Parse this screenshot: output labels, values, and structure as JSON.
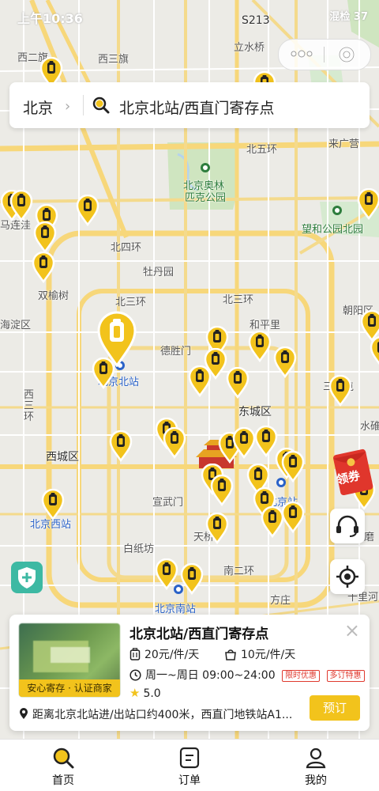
{
  "status_bar": {
    "time": "上午10:36",
    "right": "混检 37"
  },
  "search": {
    "city": "北京",
    "chevron": "›",
    "query": "北京北站/西直门寄存点"
  },
  "map_labels": [
    {
      "text": "S213",
      "cls": "dark"
    },
    {
      "text": "立水桥",
      "cls": ""
    },
    {
      "text": "西二旗",
      "cls": ""
    },
    {
      "text": "西三旗",
      "cls": ""
    },
    {
      "text": "北五环",
      "cls": ""
    },
    {
      "text": "来广营",
      "cls": ""
    },
    {
      "text": "北京奥林",
      "cls": "green"
    },
    {
      "text": "匹克公园",
      "cls": "green"
    },
    {
      "text": "望和公园北园",
      "cls": "green"
    },
    {
      "text": "马连洼",
      "cls": ""
    },
    {
      "text": "北四环",
      "cls": ""
    },
    {
      "text": "牡丹园",
      "cls": ""
    },
    {
      "text": "双榆树",
      "cls": ""
    },
    {
      "text": "北三环",
      "cls": ""
    },
    {
      "text": "北三环",
      "cls": ""
    },
    {
      "text": "朝阳区",
      "cls": ""
    },
    {
      "text": "和平里",
      "cls": ""
    },
    {
      "text": "海淀区",
      "cls": ""
    },
    {
      "text": "德胜门",
      "cls": ""
    },
    {
      "text": "北京北站",
      "cls": "blue"
    },
    {
      "text": "三元屯",
      "cls": ""
    },
    {
      "text": "西",
      "cls": ""
    },
    {
      "text": "三",
      "cls": ""
    },
    {
      "text": "环",
      "cls": ""
    },
    {
      "text": "东城区",
      "cls": "dark"
    },
    {
      "text": "水碓",
      "cls": ""
    },
    {
      "text": "西城区",
      "cls": "dark"
    },
    {
      "text": "宣武门",
      "cls": ""
    },
    {
      "text": "北京站",
      "cls": "blue"
    },
    {
      "text": "北京西站",
      "cls": "blue"
    },
    {
      "text": "天桥",
      "cls": ""
    },
    {
      "text": "南磨",
      "cls": ""
    },
    {
      "text": "白纸坊",
      "cls": ""
    },
    {
      "text": "南二环",
      "cls": ""
    },
    {
      "text": "北京南站",
      "cls": "blue"
    },
    {
      "text": "方庄",
      "cls": ""
    },
    {
      "text": "十里河",
      "cls": ""
    }
  ],
  "coupon": {
    "label": "领券"
  },
  "card": {
    "title": "北京北站/西直门寄存点",
    "badge": "安心寄存 · 认证商家",
    "price_large": "20元/件/天",
    "price_small": "10元/件/天",
    "hours": "周一~周日 09:00~24:00",
    "tag1": "限时优惠",
    "tag2": "多订特惠",
    "rating": "5.0",
    "distance": "距离北京北站进/出站口约400米，西直门地铁站A1...",
    "book": "预订",
    "close": "×"
  },
  "tabs": [
    {
      "label": "首页"
    },
    {
      "label": "订单"
    },
    {
      "label": "我的"
    }
  ],
  "colors": {
    "accent": "#f2c31c",
    "road": "#f7d77a",
    "park": "#cfe5c0"
  }
}
